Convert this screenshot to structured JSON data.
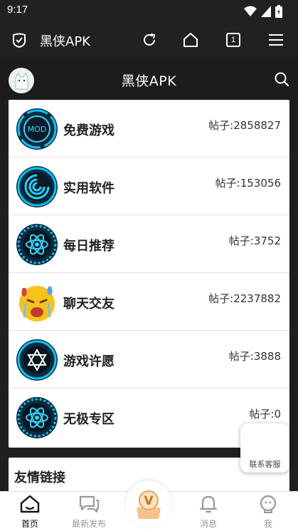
{
  "status_bar": {
    "time": "9:17"
  },
  "browser": {
    "title": "黑侠APK",
    "tab_count": "1"
  },
  "app": {
    "title": "黑侠APK"
  },
  "categories": [
    {
      "name": "免费游戏",
      "count": "帖子:2858827",
      "icon": "mod-badge-icon",
      "icon_text": "MOD"
    },
    {
      "name": "实用软件",
      "count": "帖子:153056",
      "icon": "swirl-icon"
    },
    {
      "name": "每日推荐",
      "count": "帖子:3752",
      "icon": "atom-icon"
    },
    {
      "name": "聊天交友",
      "count": "帖子:2237882",
      "icon": "crying-emoji-icon"
    },
    {
      "name": "游戏许愿",
      "count": "帖子:3888",
      "icon": "star-of-david-icon"
    },
    {
      "name": "无极专区",
      "count": "帖子:0",
      "icon": "atom-icon"
    }
  ],
  "links": {
    "title": "友情链接"
  },
  "customer_service": {
    "label": "联系客服"
  },
  "bottom_nav": [
    {
      "label": "首页",
      "icon": "home-icon",
      "active": true
    },
    {
      "label": "最新发布",
      "icon": "chat-icon",
      "active": false
    },
    {
      "label": "",
      "icon": "vip-center-icon",
      "center_text": "V"
    },
    {
      "label": "消息",
      "icon": "bell-icon",
      "active": false
    },
    {
      "label": "我",
      "icon": "profile-icon",
      "active": false
    }
  ],
  "colors": {
    "accent_cyan": "#00c8ff",
    "dark_bg": "#1f1f1f"
  }
}
